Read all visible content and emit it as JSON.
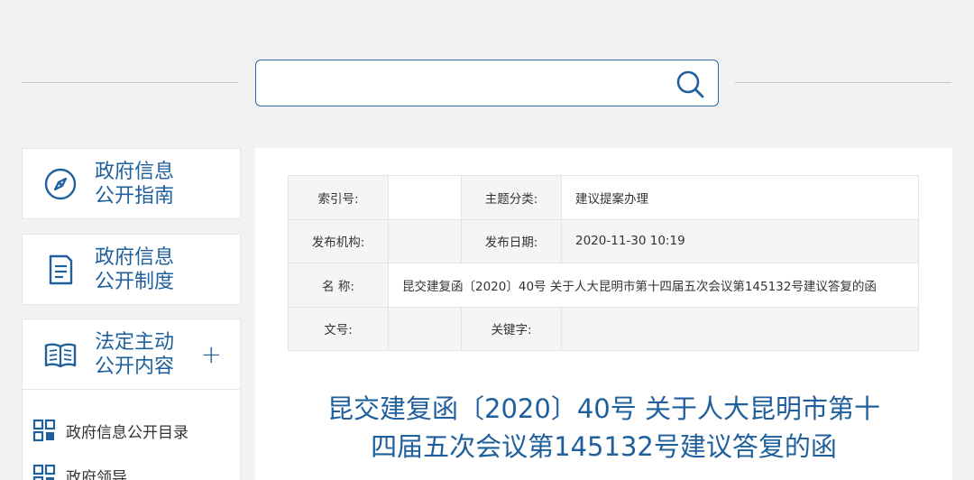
{
  "search": {
    "placeholder": ""
  },
  "sidebar": {
    "cards": [
      {
        "label_line1": "政府信息",
        "label_line2": "公开指南",
        "icon": "compass-icon"
      },
      {
        "label_line1": "政府信息",
        "label_line2": "公开制度",
        "icon": "document-icon"
      },
      {
        "label_line1": "法定主动",
        "label_line2": "公开内容",
        "icon": "book-icon",
        "expand": "+"
      }
    ],
    "sub_items": [
      {
        "label": "政府信息公开目录",
        "icon": "grid-icon"
      },
      {
        "label": "政府领导",
        "icon": "grid-icon"
      }
    ]
  },
  "meta": {
    "index_label": "索引号:",
    "index_value": "",
    "topic_label": "主题分类:",
    "topic_value": "建议提案办理",
    "org_label": "发布机构:",
    "org_value": "",
    "date_label": "发布日期:",
    "date_value": "2020-11-30 10:19",
    "name_label": "名 称:",
    "name_value": "昆交建复函〔2020〕40号 关于人大昆明市第十四届五次会议第145132号建议答复的函",
    "docno_label": "文号:",
    "docno_value": "",
    "keyword_label": "关键字:",
    "keyword_value": ""
  },
  "article": {
    "title_line1": "昆交建复函〔2020〕40号 关于人大昆明市第十",
    "title_line2": "四届五次会议第145132号建议答复的函"
  },
  "colors": {
    "accent": "#1f5f9c",
    "border": "#2a6aa8",
    "background": "#f2f2f2"
  }
}
